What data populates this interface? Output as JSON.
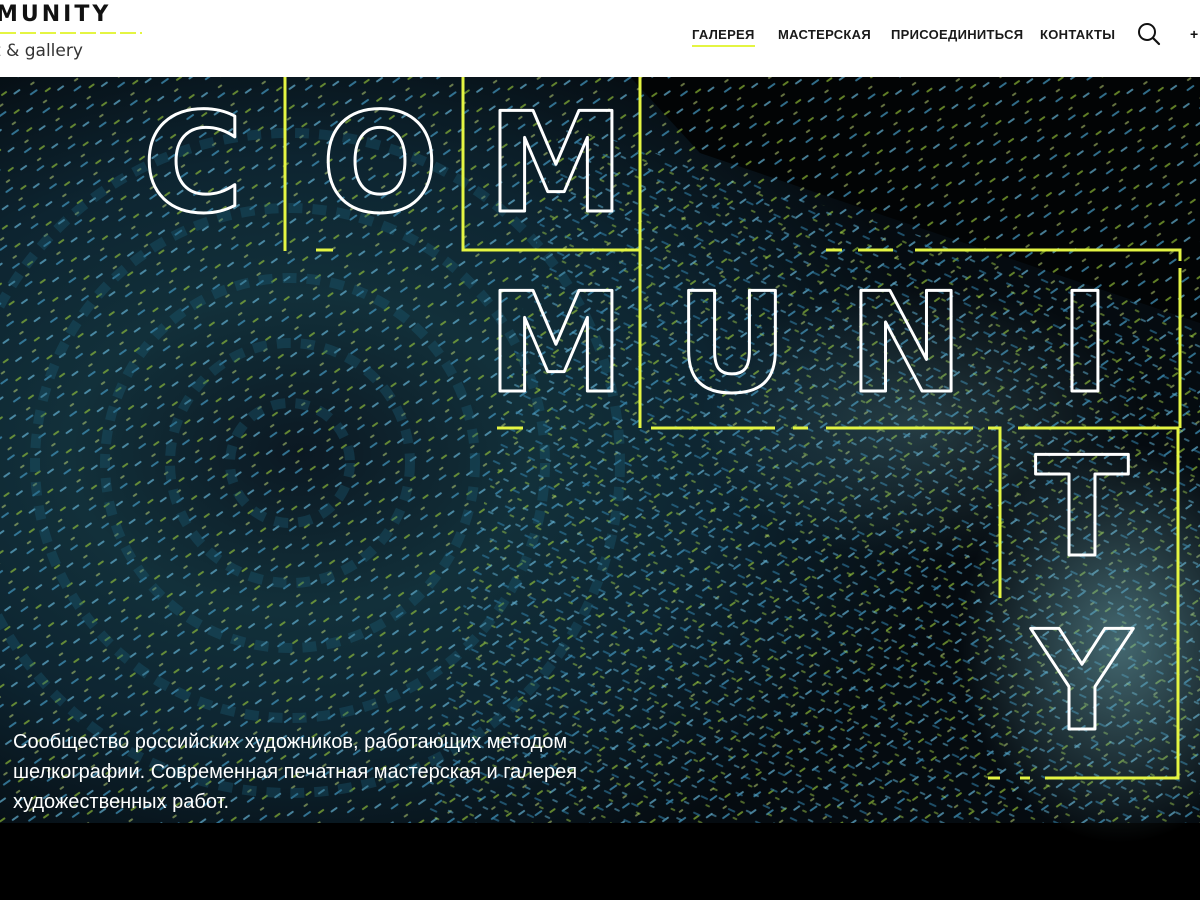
{
  "logo": {
    "title": "MUNITY",
    "subtitle": "t & gallery"
  },
  "nav": {
    "items": [
      {
        "label": "ГАЛЕРЕЯ",
        "active": true
      },
      {
        "label": "МАСТЕРСКАЯ",
        "active": false
      },
      {
        "label": "ПРИСОЕДИНИТЬСЯ",
        "active": false
      },
      {
        "label": "КОНТАКТЫ",
        "active": false
      }
    ],
    "search_icon": "search-icon",
    "more_label": "+"
  },
  "hero": {
    "letters": [
      "C",
      "O",
      "M",
      "M",
      "U",
      "N",
      "I",
      "T",
      "Y"
    ],
    "description": "Сообщество российских художников, работающих методом шелкографии. Современная печатная мастерская и галерея художественных работ."
  },
  "colors": {
    "accent": "#e4f542",
    "header_bg": "#ffffff",
    "hero_text": "#ffffff",
    "nav_text": "#1a1a1a"
  }
}
